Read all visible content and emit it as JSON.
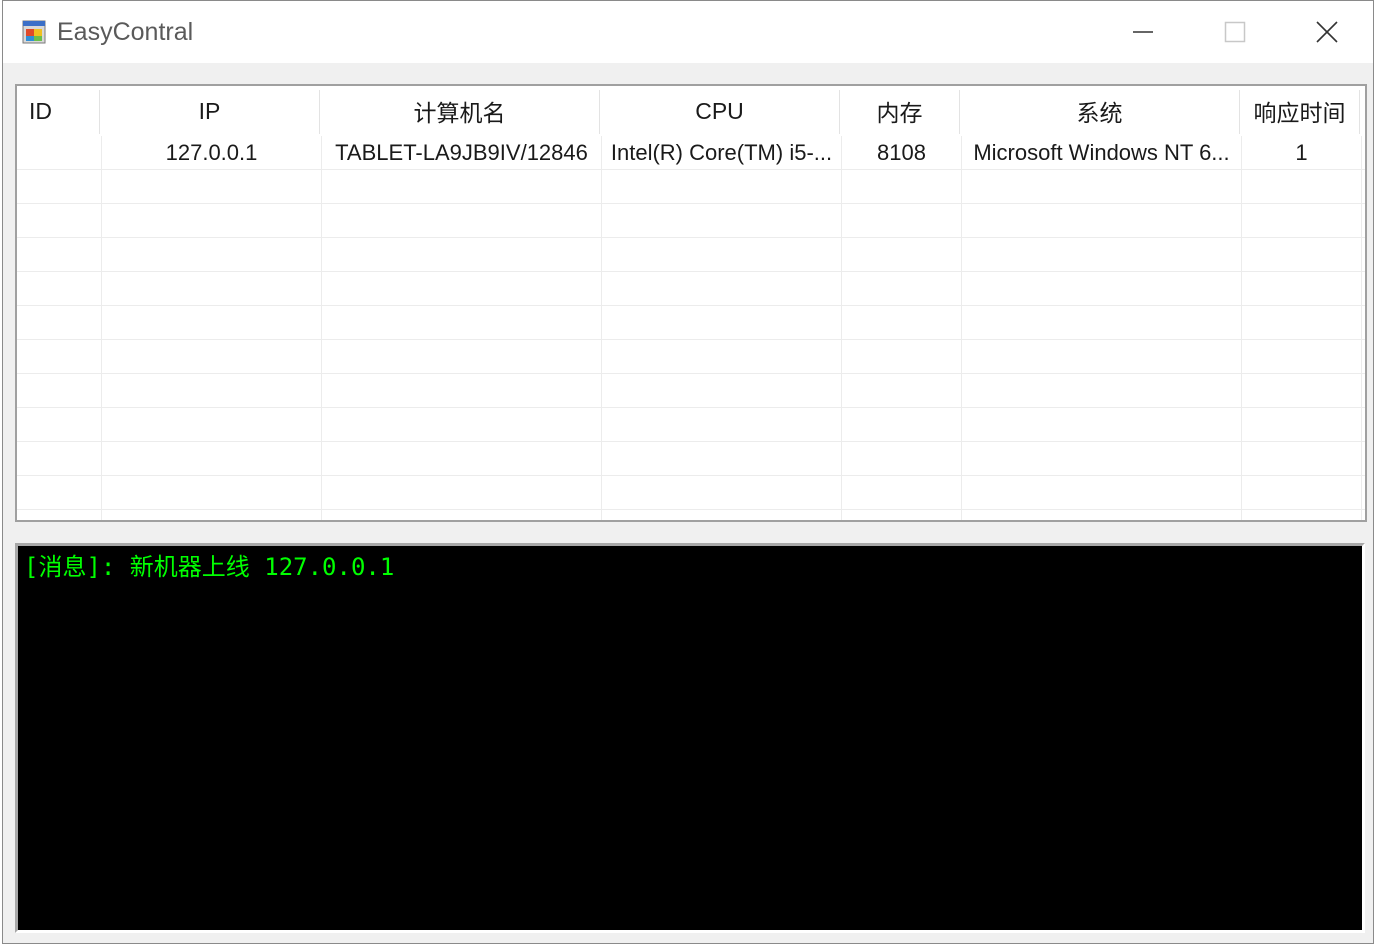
{
  "window": {
    "title": "EasyContral"
  },
  "titlebar": {
    "icons": [
      "app-icon",
      "minimize-icon",
      "maximize-icon",
      "close-icon"
    ]
  },
  "table": {
    "columns": [
      "ID",
      "IP",
      "计算机名",
      "CPU",
      "内存",
      "系统",
      "响应时间"
    ],
    "rows": [
      {
        "id": "",
        "ip": "127.0.0.1",
        "computer_name": "TABLET-LA9JB9IV/12846",
        "cpu": "Intel(R) Core(TM) i5-...",
        "memory": "8108",
        "system": "Microsoft Windows NT 6...",
        "response_time": "1"
      }
    ]
  },
  "console": {
    "lines": [
      "[消息]: 新机器上线 127.0.0.1"
    ],
    "text_color": "#00ff00",
    "background": "#000000"
  }
}
